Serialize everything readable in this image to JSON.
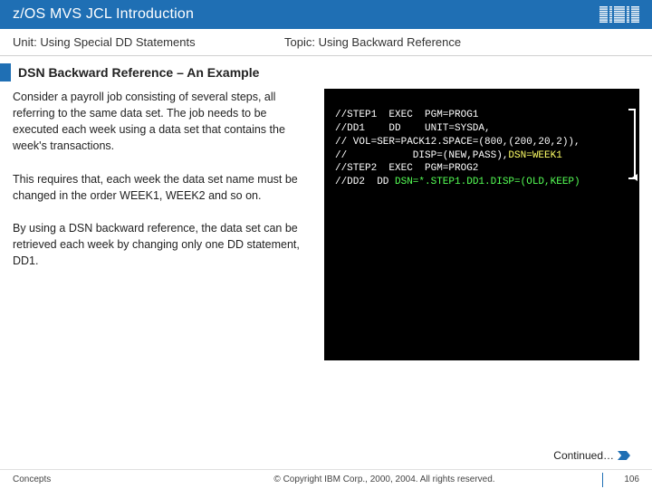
{
  "header": {
    "title": "z/OS MVS JCL Introduction",
    "logo": "IBM"
  },
  "subheader": {
    "unit_label": "Unit: Using Special DD Statements",
    "topic_label": "Topic: Using Backward Reference"
  },
  "section": {
    "title": "DSN Backward Reference – An Example"
  },
  "body": {
    "p1": "Consider a payroll job consisting of several steps, all referring to the same data set. The job needs to be executed each week using a data set that contains the week's transactions.",
    "p2": "This requires that, each week the data set name must be changed in the order WEEK1, WEEK2 and so on.",
    "p3": "By using a DSN backward reference, the data set can be retrieved each week by changing only one DD statement, DD1."
  },
  "code": {
    "l1a": "//STEP1  EXEC  PGM=PROG1",
    "l2a": "//DD1    DD    UNIT=SYSDA,",
    "l3a": "// VOL=SER=PACK12.SPACE=(800,(200,20,2)),",
    "l4a": "//           DISP=(NEW,PASS),",
    "l4b": "DSN=WEEK1",
    "l5a": "//STEP2  EXEC  PGM=PROG2",
    "l6a": "//DD2  DD ",
    "l6b": "DSN=*.STEP1.DD1.DISP=(OLD,KEEP)"
  },
  "continued": "Continued…",
  "footer": {
    "left": "Concepts",
    "center": "© Copyright IBM Corp., 2000, 2004. All rights reserved.",
    "page": "106"
  }
}
